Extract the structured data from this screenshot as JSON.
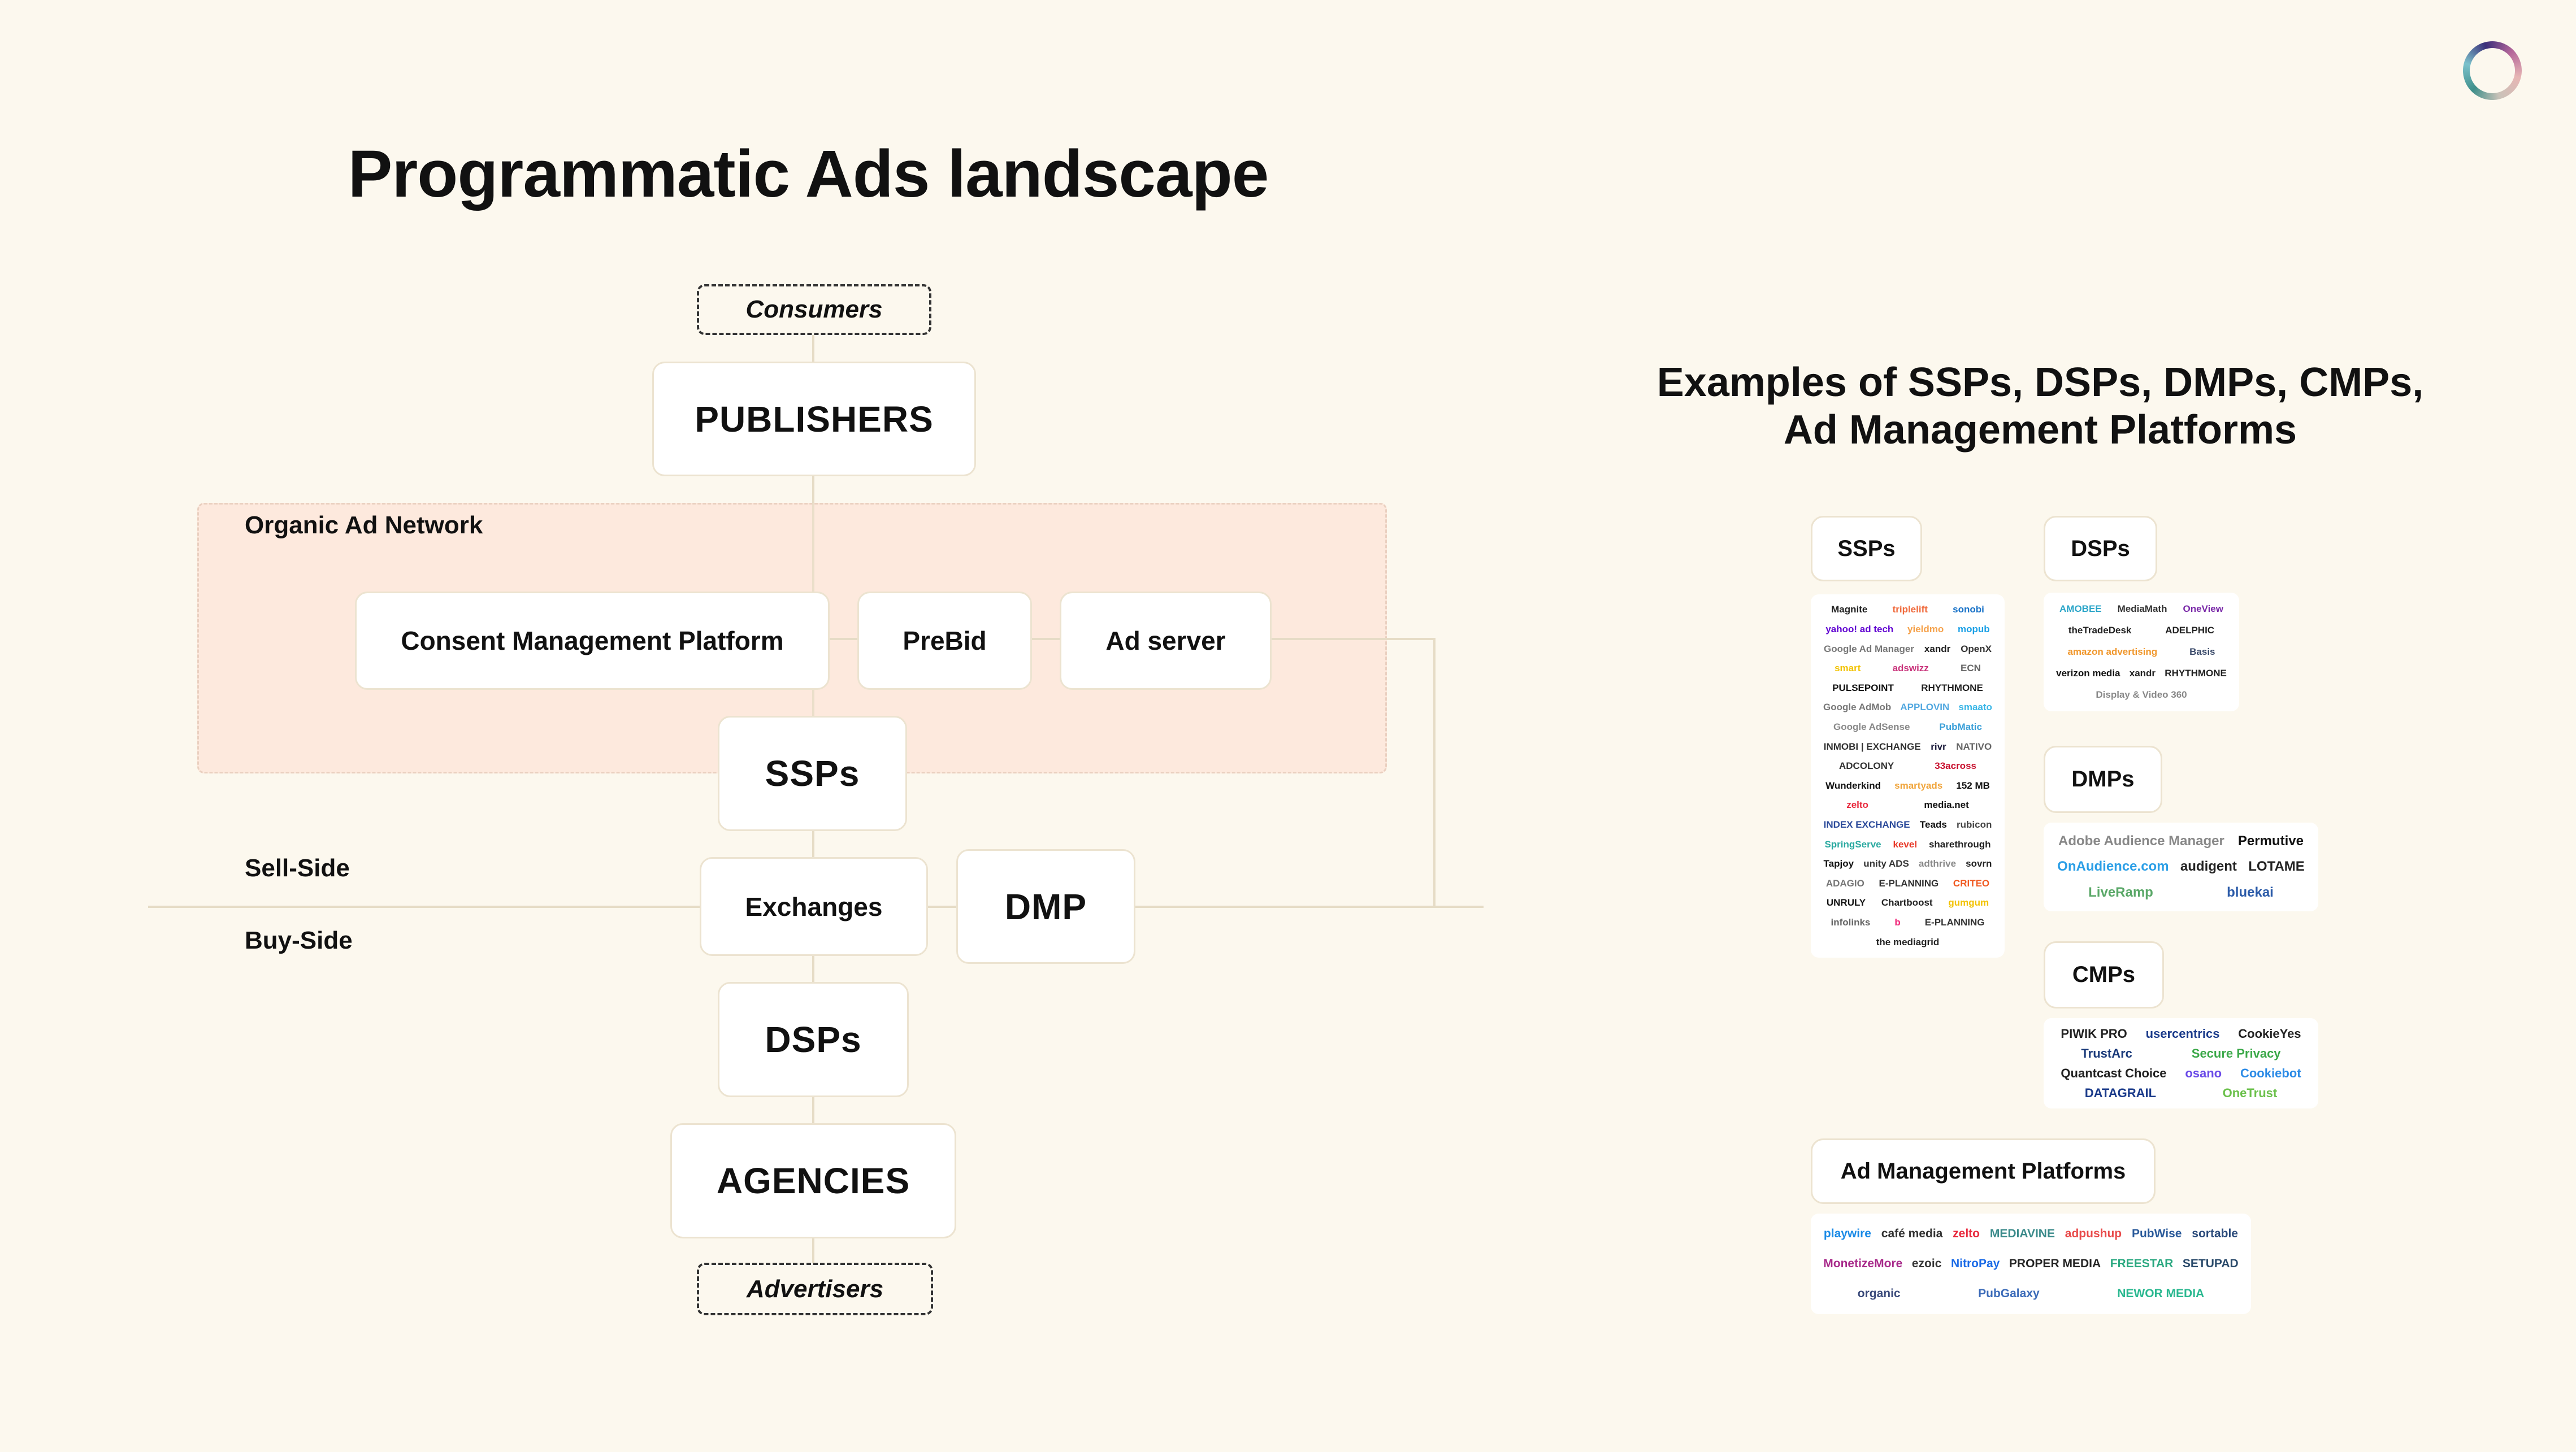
{
  "title": "Programmatic Ads landscape",
  "diagram": {
    "consumers": "Consumers",
    "publishers": "PUBLISHERS",
    "organic_network": "Organic Ad Network",
    "cmp": "Consent Management Platform",
    "prebid": "PreBid",
    "ad_server": "Ad server",
    "ssps": "SSPs",
    "exchanges": "Exchanges",
    "dmp": "DMP",
    "dsps": "DSPs",
    "agencies": "AGENCIES",
    "advertisers": "Advertisers",
    "sell_side": "Sell-Side",
    "buy_side": "Buy-Side"
  },
  "examples": {
    "heading_line1": "Examples of SSPs, DSPs, DMPs, CMPs,",
    "heading_line2": "Ad Management Platforms",
    "categories": [
      {
        "label": "SSPs",
        "logos": [
          {
            "name": "Magnite",
            "color": "#222"
          },
          {
            "name": "triplelift",
            "color": "#f06a3c"
          },
          {
            "name": "sonobi",
            "color": "#1a73c8"
          },
          {
            "name": "yahoo! ad tech",
            "color": "#5f01d1"
          },
          {
            "name": "yieldmo",
            "color": "#f5a14a"
          },
          {
            "name": "mopub",
            "color": "#1aa0e6"
          },
          {
            "name": "Google Ad Manager",
            "color": "#777"
          },
          {
            "name": "xandr",
            "color": "#222"
          },
          {
            "name": "OpenX",
            "color": "#333"
          },
          {
            "name": "smart",
            "color": "#f2c200"
          },
          {
            "name": "adswizz",
            "color": "#c8327a"
          },
          {
            "name": "ECN",
            "color": "#666"
          },
          {
            "name": "PULSEPOINT",
            "color": "#111"
          },
          {
            "name": "RHYTHMONE",
            "color": "#222"
          },
          {
            "name": "Google AdMob",
            "color": "#777"
          },
          {
            "name": "APPLOVIN",
            "color": "#52a8e0"
          },
          {
            "name": "smaato",
            "color": "#38b5e6"
          },
          {
            "name": "Google AdSense",
            "color": "#888"
          },
          {
            "name": "PubMatic",
            "color": "#3a9fd8"
          },
          {
            "name": "INMOBI | EXCHANGE",
            "color": "#333"
          },
          {
            "name": "rivr",
            "color": "#1a1a3a"
          },
          {
            "name": "NATIVO",
            "color": "#666"
          },
          {
            "name": "ADCOLONY",
            "color": "#333"
          },
          {
            "name": "33across",
            "color": "#c8102e"
          },
          {
            "name": "Wunderkind",
            "color": "#111"
          },
          {
            "name": "smartyads",
            "color": "#f0a43a"
          },
          {
            "name": "152 MB",
            "color": "#111"
          },
          {
            "name": "zelto",
            "color": "#e8283c"
          },
          {
            "name": "media.net",
            "color": "#111"
          },
          {
            "name": "INDEX EXCHANGE",
            "color": "#2b4a9a"
          },
          {
            "name": "Teads",
            "color": "#111"
          },
          {
            "name": "rubicon",
            "color": "#444"
          },
          {
            "name": "SpringServe",
            "color": "#2aa9a0"
          },
          {
            "name": "kevel",
            "color": "#e83a2a"
          },
          {
            "name": "sharethrough",
            "color": "#222"
          },
          {
            "name": "Tapjoy",
            "color": "#111"
          },
          {
            "name": "unity ADS",
            "color": "#333"
          },
          {
            "name": "adthrive",
            "color": "#888"
          },
          {
            "name": "sovrn",
            "color": "#222"
          },
          {
            "name": "ADAGIO",
            "color": "#777"
          },
          {
            "name": "E-PLANNING",
            "color": "#333"
          },
          {
            "name": "CRITEO",
            "color": "#f05a22"
          },
          {
            "name": "UNRULY",
            "color": "#111"
          },
          {
            "name": "Chartboost",
            "color": "#222"
          },
          {
            "name": "gumgum",
            "color": "#f2c200"
          },
          {
            "name": "infolinks",
            "color": "#666"
          },
          {
            "name": "b",
            "color": "#f0287a"
          },
          {
            "name": "E-PLANNING",
            "color": "#333"
          },
          {
            "name": "the mediagrid",
            "color": "#222"
          }
        ]
      },
      {
        "label": "DSPs",
        "logos": [
          {
            "name": "AMOBEE",
            "color": "#2aa5c8"
          },
          {
            "name": "MediaMath",
            "color": "#333"
          },
          {
            "name": "OneView",
            "color": "#7a2aa8"
          },
          {
            "name": "theTradeDesk",
            "color": "#222"
          },
          {
            "name": "ADELPHIC",
            "color": "#222"
          },
          {
            "name": "amazon advertising",
            "color": "#f0962a"
          },
          {
            "name": "Basis",
            "color": "#3a4a6a"
          },
          {
            "name": "verizon media",
            "color": "#111"
          },
          {
            "name": "xandr",
            "color": "#222"
          },
          {
            "name": "RHYTHMONE",
            "color": "#222"
          },
          {
            "name": "Display & Video 360",
            "color": "#888"
          }
        ]
      },
      {
        "label": "DMPs",
        "logos": [
          {
            "name": "Adobe Audience Manager",
            "color": "#888"
          },
          {
            "name": "Permutive",
            "color": "#111"
          },
          {
            "name": "OnAudience.com",
            "color": "#2a9ee6"
          },
          {
            "name": "audigent",
            "color": "#222"
          },
          {
            "name": "LOTAME",
            "color": "#222"
          },
          {
            "name": "LiveRamp",
            "color": "#5aa868"
          },
          {
            "name": "bluekai",
            "color": "#2a5aa8"
          }
        ]
      },
      {
        "label": "CMPs",
        "logos": [
          {
            "name": "PIWIK PRO",
            "color": "#222"
          },
          {
            "name": "usercentrics",
            "color": "#1a3a8a"
          },
          {
            "name": "CookieYes",
            "color": "#222"
          },
          {
            "name": "TrustArc",
            "color": "#1a3a7a"
          },
          {
            "name": "Secure Privacy",
            "color": "#3aa848"
          },
          {
            "name": "Quantcast Choice",
            "color": "#222"
          },
          {
            "name": "osano",
            "color": "#6a4ae8"
          },
          {
            "name": "Cookiebot",
            "color": "#2a8ae6"
          },
          {
            "name": "DATAGRAIL",
            "color": "#1a3a8a"
          },
          {
            "name": "OneTrust",
            "color": "#6ac04a"
          }
        ]
      },
      {
        "label": "Ad Management Platforms",
        "logos": [
          {
            "name": "playwire",
            "color": "#1a8ae6"
          },
          {
            "name": "café media",
            "color": "#333"
          },
          {
            "name": "zelto",
            "color": "#e8283c"
          },
          {
            "name": "MEDIAVINE",
            "color": "#3a8a8a"
          },
          {
            "name": "adpushup",
            "color": "#e84a4a"
          },
          {
            "name": "PubWise",
            "color": "#2a5a9a"
          },
          {
            "name": "sortable",
            "color": "#2a4a7a"
          },
          {
            "name": "MonetizeMore",
            "color": "#a82a8a"
          },
          {
            "name": "ezoic",
            "color": "#333"
          },
          {
            "name": "NitroPay",
            "color": "#1a6ae6"
          },
          {
            "name": "PROPER MEDIA",
            "color": "#222"
          },
          {
            "name": "FREESTAR",
            "color": "#2aa880"
          },
          {
            "name": "SETUPAD",
            "color": "#2a4a6a"
          },
          {
            "name": "organic",
            "color": "#3a4a7a"
          },
          {
            "name": "PubGalaxy",
            "color": "#3a6ab8"
          },
          {
            "name": "NEWOR MEDIA",
            "color": "#2ab890"
          }
        ]
      }
    ]
  }
}
